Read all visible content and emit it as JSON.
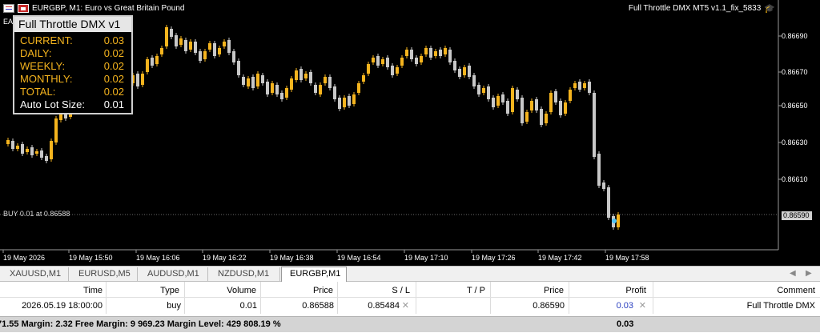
{
  "window": {
    "title": "EURGBP, M1:  Euro vs Great Britain Pound",
    "ea_name": "Full Throttle DMX MT5 v1.1_fix_5833",
    "ea_tag": "EA"
  },
  "panel": {
    "title": "Full Throttle DMX v1",
    "rows": [
      {
        "label": "CURRENT:",
        "value": "0.03"
      },
      {
        "label": "DAILY:",
        "value": "0.02"
      },
      {
        "label": "WEEKLY:",
        "value": "0.02"
      },
      {
        "label": "MONTHLY:",
        "value": "0.02"
      },
      {
        "label": "TOTAL:",
        "value": "0.02"
      },
      {
        "label": "Auto Lot Size:",
        "value": "0.01"
      }
    ]
  },
  "price_axis": [
    "0.86690",
    "0.86670",
    "0.86650",
    "0.86630",
    "0.86610"
  ],
  "current_price": "0.86590",
  "buy_line_label": "BUY 0.01 at 0.86588",
  "time_axis": [
    "19 May 2026",
    "19 May 15:50",
    "19 May 16:06",
    "19 May 16:22",
    "19 May 16:38",
    "19 May 16:54",
    "19 May 17:10",
    "19 May 17:26",
    "19 May 17:42",
    "19 May 17:58"
  ],
  "colors": {
    "bull": "#f5b41e",
    "bear": "#c8c8c8",
    "background": "#000000"
  },
  "tabs": [
    "XAUUSD,M1",
    "EURUSD,M5",
    "AUDUSD,M1",
    "NZDUSD,M1",
    "EURGBP,M1"
  ],
  "active_tab": "EURGBP,M1",
  "terminal": {
    "headers": {
      "time": "Time",
      "type": "Type",
      "volume": "Volume",
      "price": "Price",
      "sl": "S / L",
      "tp": "T / P",
      "price2": "Price",
      "profit": "Profit",
      "comment": "Comment"
    },
    "row": {
      "time": "2026.05.19 18:00:00",
      "type": "buy",
      "volume": "0.01",
      "price": "0.86588",
      "sl": "0.85484",
      "tp": "",
      "price2": "0.86590",
      "profit": "0.03",
      "comment": "Full Throttle DMX"
    },
    "summary": "71.55  Margin: 2.32  Free Margin: 9 969.23  Margin Level: 429 808.19 %",
    "summary_profit": "0.03"
  }
}
